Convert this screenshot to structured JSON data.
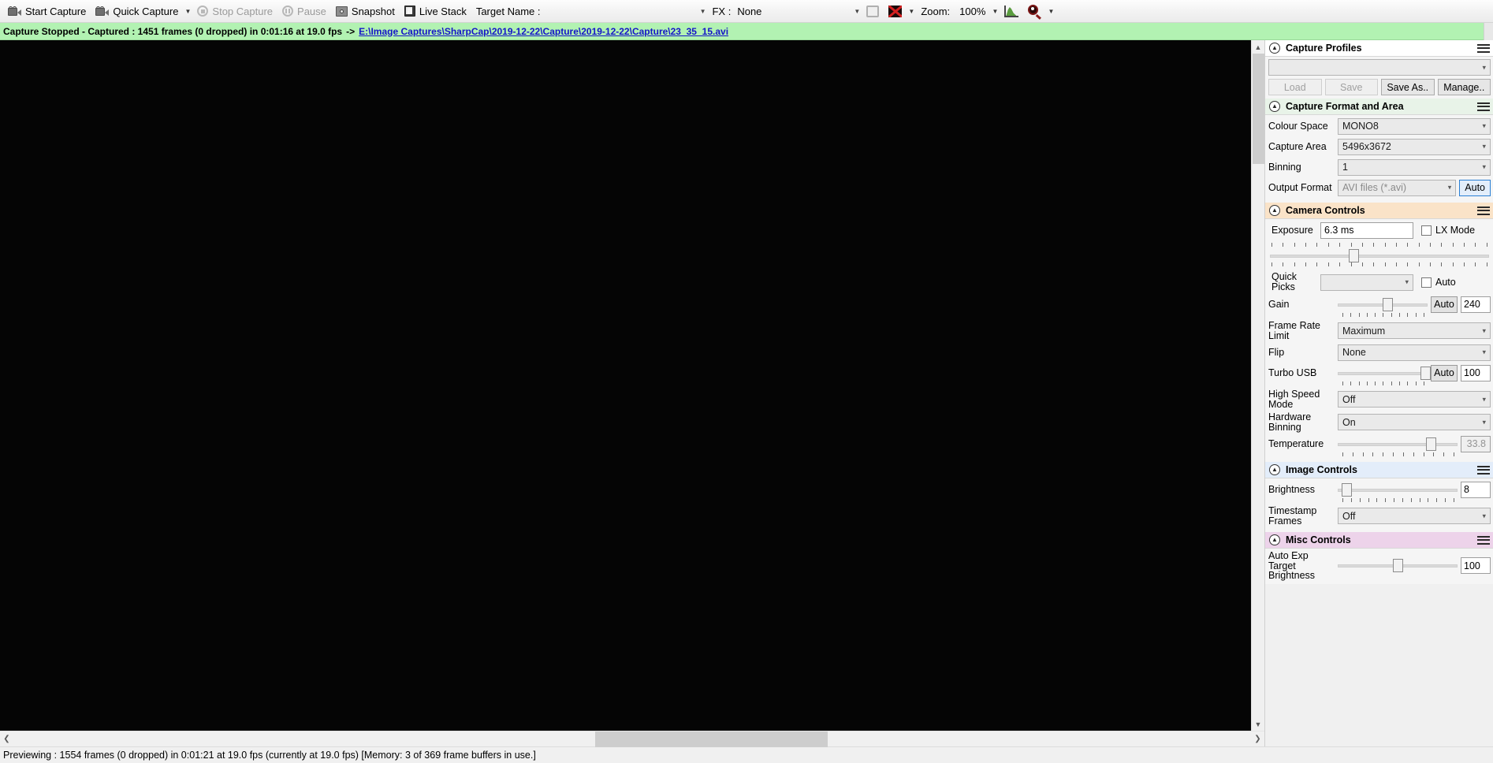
{
  "toolbar": {
    "start_capture": "Start Capture",
    "quick_capture": "Quick Capture",
    "stop_capture": "Stop Capture",
    "pause": "Pause",
    "snapshot": "Snapshot",
    "live_stack": "Live Stack",
    "target_name_label": "Target Name :",
    "target_name_value": "",
    "fx_label": "FX :",
    "fx_value": "None",
    "zoom_label": "Zoom:",
    "zoom_value": "100%",
    "icons": {
      "start": "camcorder-icon",
      "quick": "camcorder-icon",
      "stop": "stop-circle-icon",
      "pause": "pause-circle-icon",
      "snapshot": "snapshot-icon",
      "stack": "live-stack-icon",
      "frame": "square-frame-icon",
      "redx": "red-x-icon",
      "histogram": "histogram-icon",
      "loupe": "magnifier-icon"
    }
  },
  "capture_status": {
    "text": "Capture Stopped - Captured : 1451 frames (0 dropped) in 0:01:16 at 19.0 fps",
    "arrow": "->",
    "path": "E:\\Image Captures\\SharpCap\\2019-12-22\\Capture\\2019-12-22\\Capture\\23_35_15.avi",
    "background": "#b2f2b2",
    "link_color": "#1414c8"
  },
  "panel": {
    "capture_profiles": {
      "title": "Capture Profiles",
      "header_color": "#ffffff",
      "profile_value": "",
      "buttons": [
        {
          "label": "Load",
          "enabled": false
        },
        {
          "label": "Save",
          "enabled": false
        },
        {
          "label": "Save As..",
          "enabled": true
        },
        {
          "label": "Manage..",
          "enabled": true
        }
      ]
    },
    "capture_format": {
      "title": "Capture Format and Area",
      "header_color": "#e8f3e8",
      "rows": [
        {
          "label": "Colour Space",
          "value": "MONO8",
          "type": "select"
        },
        {
          "label": "Capture Area",
          "value": "5496x3672",
          "type": "select"
        },
        {
          "label": "Binning",
          "value": "1",
          "type": "select"
        },
        {
          "label": "Output Format",
          "value": "AVI files (*.avi)",
          "type": "select-disabled",
          "button": "Auto"
        }
      ]
    },
    "camera_controls": {
      "title": "Camera Controls",
      "header_color": "#fae3c8",
      "exposure_label": "Exposure",
      "exposure_value": "6.3 ms",
      "lx_mode_label": "LX Mode",
      "lx_mode_checked": false,
      "quick_picks_label": "Quick Picks",
      "quick_picks_value": "",
      "quick_picks_auto_label": "Auto",
      "quick_picks_auto_checked": false,
      "gain_label": "Gain",
      "gain_auto_label": "Auto",
      "gain_value": "240",
      "frame_rate_label": "Frame Rate Limit",
      "frame_rate_value": "Maximum",
      "flip_label": "Flip",
      "flip_value": "None",
      "turbo_usb_label": "Turbo USB",
      "turbo_usb_auto_label": "Auto",
      "turbo_usb_value": "100",
      "high_speed_label": "High Speed Mode",
      "high_speed_value": "Off",
      "hardware_binning_label": "Hardware Binning",
      "hardware_binning_value": "On",
      "temperature_label": "Temperature",
      "temperature_value": "33.8"
    },
    "image_controls": {
      "title": "Image Controls",
      "header_color": "#e3edfa",
      "brightness_label": "Brightness",
      "brightness_value": "8",
      "timestamp_label": "Timestamp Frames",
      "timestamp_value": "Off"
    },
    "misc_controls": {
      "title": "Misc Controls",
      "header_color": "#edd3ea",
      "auto_exp_label": "Auto Exp Target Brightness",
      "auto_exp_value": "100"
    }
  },
  "statusbar": {
    "text": "Previewing : 1554 frames (0 dropped) in 0:01:21 at 19.0 fps  (currently at 19.0 fps) [Memory: 3 of 369 frame buffers in use.]"
  }
}
